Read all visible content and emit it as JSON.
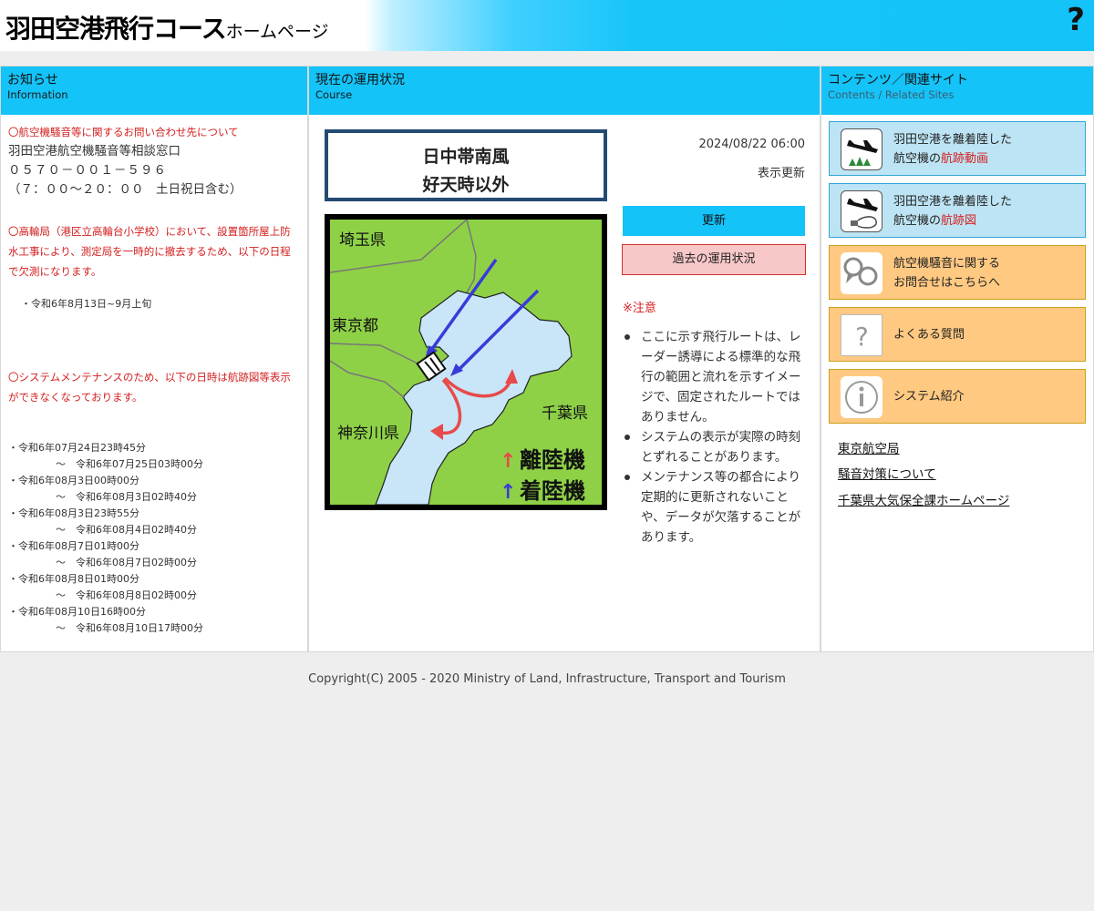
{
  "header": {
    "title": "羽田空港飛行コース",
    "title_sub": "ホームページ",
    "help_label": "?"
  },
  "left": {
    "title": "お知らせ",
    "subtitle": "Information",
    "contact_heading": "〇航空機騒音等に関するお問い合わせ先について",
    "contact_office": "羽田空港航空機騒音等相談窓口",
    "contact_phone": "０５７０－００１－５９６",
    "contact_hours": "（７：００～２０：００　土日祝日含む）",
    "takanawa_notice": "〇高輪局（港区立高輪台小学校）において、設置箇所屋上防水工事により、測定局を一時的に撤去するため、以下の日程で欠測になります。",
    "takanawa_period": "・令和6年8月13日~9月上旬",
    "maint_notice": "〇システムメンテナンスのため、以下の日時は航跡図等表示ができなくなっております。",
    "maint_items": [
      {
        "start": "・令和6年07月24日23時45分",
        "end": "～　令和6年07月25日03時00分"
      },
      {
        "start": "・令和6年08月3日00時00分",
        "end": "～　令和6年08月3日02時40分"
      },
      {
        "start": "・令和6年08月3日23時55分",
        "end": "～　令和6年08月4日02時40分"
      },
      {
        "start": "・令和6年08月7日01時00分",
        "end": "～　令和6年08月7日02時00分"
      },
      {
        "start": "・令和6年08月8日01時00分",
        "end": "～　令和6年08月8日02時00分"
      },
      {
        "start": "・令和6年08月10日16時00分",
        "end": "～　令和6年08月10日17時00分"
      }
    ]
  },
  "middle": {
    "title": "現在の運用状況",
    "subtitle": "Course",
    "status_line1": "日中帯南風",
    "status_line2": "好天時以外",
    "datetime": "2024/08/22 06:00",
    "refresh_label": "表示更新",
    "update_button": "更新",
    "past_button": "過去の運用状況",
    "note_title": "※注意",
    "notes": [
      "ここに示す飛行ルートは、レーダー誘導による標準的な飛行の範囲と流れを示すイメージで、固定されたルートではありません。",
      "システムの表示が実際の時刻とずれることがあります。",
      "メンテナンス等の都合により定期的に更新されないことや、データが欠落することがあります。"
    ],
    "map": {
      "saitama": "埼玉県",
      "tokyo": "東京都",
      "kanagawa": "神奈川県",
      "chiba": "千葉県",
      "takeoff": "離陸機",
      "landing": "着陸機",
      "arrow": "↑"
    }
  },
  "right": {
    "title": "コンテンツ／関連サイト",
    "subtitle": "Contents / Related Sites",
    "buttons": [
      {
        "line1": "羽田空港を離着陸した",
        "line2a": "航空機の",
        "line2b": "航跡動画"
      },
      {
        "line1": "羽田空港を離着陸した",
        "line2a": "航空機の",
        "line2b": "航跡図"
      },
      {
        "line1": "航空機騒音に関する",
        "line2": "お問合せはこちらへ"
      },
      {
        "label": "よくある質問"
      },
      {
        "label": "システム紹介"
      }
    ],
    "links": [
      "東京航空局",
      "騒音対策について",
      "千葉県大気保全課ホームページ"
    ]
  },
  "footer": {
    "copyright": "Copyright(C) 2005 - 2020 Ministry of Land, Infrastructure, Transport and Tourism"
  },
  "colors": {
    "accent": "#14c3f8",
    "warning": "#d42020",
    "map_land": "#8ed147",
    "map_sea": "#c8e6f8",
    "takeoff_arrow": "#e84a4a",
    "landing_arrow": "#3a3ad8"
  }
}
